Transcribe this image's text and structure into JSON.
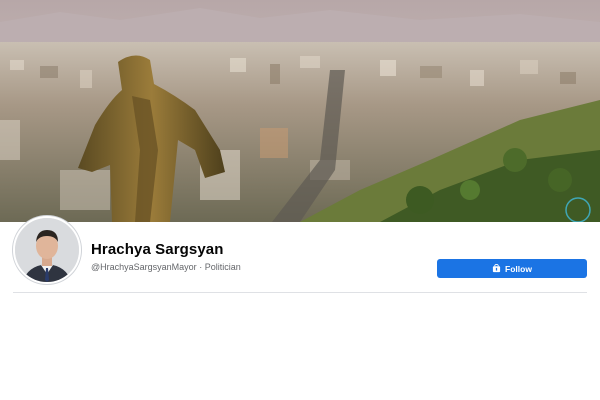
{
  "profile": {
    "name": "Hrachya Sargsyan",
    "handle": "@HrachyaSargsyanMayor",
    "separator": " · ",
    "category": "Politician"
  },
  "follow_button": {
    "label": "Follow",
    "icon": "follow-icon",
    "color": "#1b74e4"
  },
  "cover": {
    "description_icon": "city-statue-cover-photo"
  }
}
